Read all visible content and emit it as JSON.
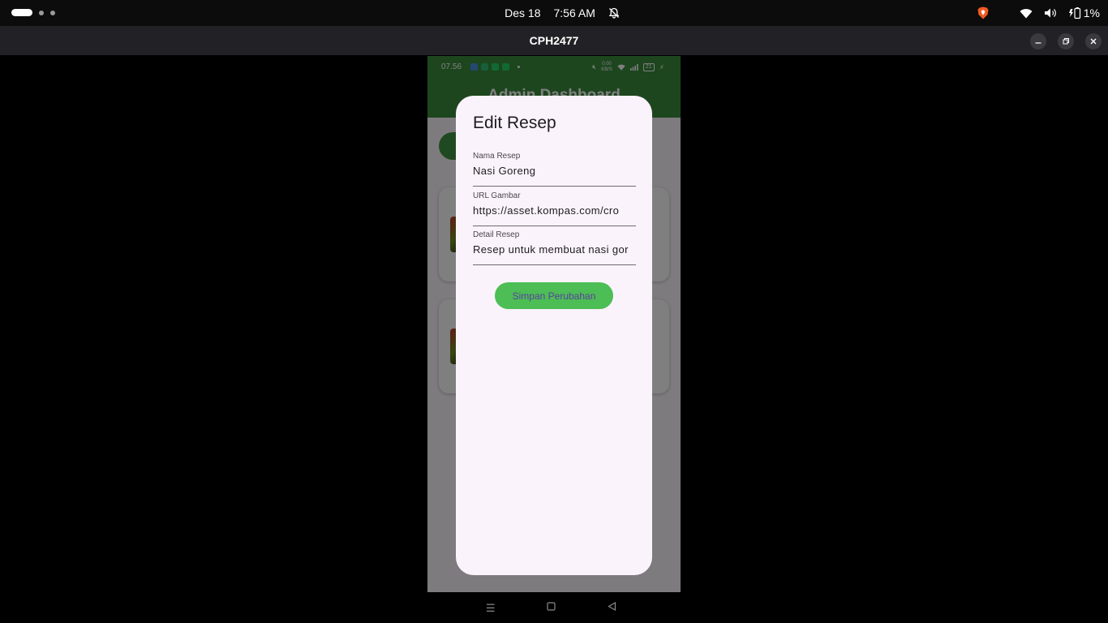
{
  "topbar": {
    "date": "Des 18",
    "time": "7:56 AM",
    "battery": "1%"
  },
  "window": {
    "title": "CPH2477"
  },
  "phone": {
    "status_time": "07.56",
    "net_speed": "0.00",
    "net_unit": "KB/S",
    "battery_level": "21",
    "appbar_title": "Admin Dashboard"
  },
  "dialog": {
    "title": "Edit Resep",
    "fields": [
      {
        "label": "Nama Resep",
        "value": "Nasi Goreng"
      },
      {
        "label": "URL Gambar",
        "value": "https://asset.kompas.com/cro"
      },
      {
        "label": "Detail Resep",
        "value": "Resep untuk membuat nasi gor"
      }
    ],
    "save_label": "Simpan Perubahan"
  },
  "colors": {
    "appbar": "#3a8c3d",
    "save_button": "#4cbe55",
    "dialog_bg": "#fbf3fb"
  }
}
